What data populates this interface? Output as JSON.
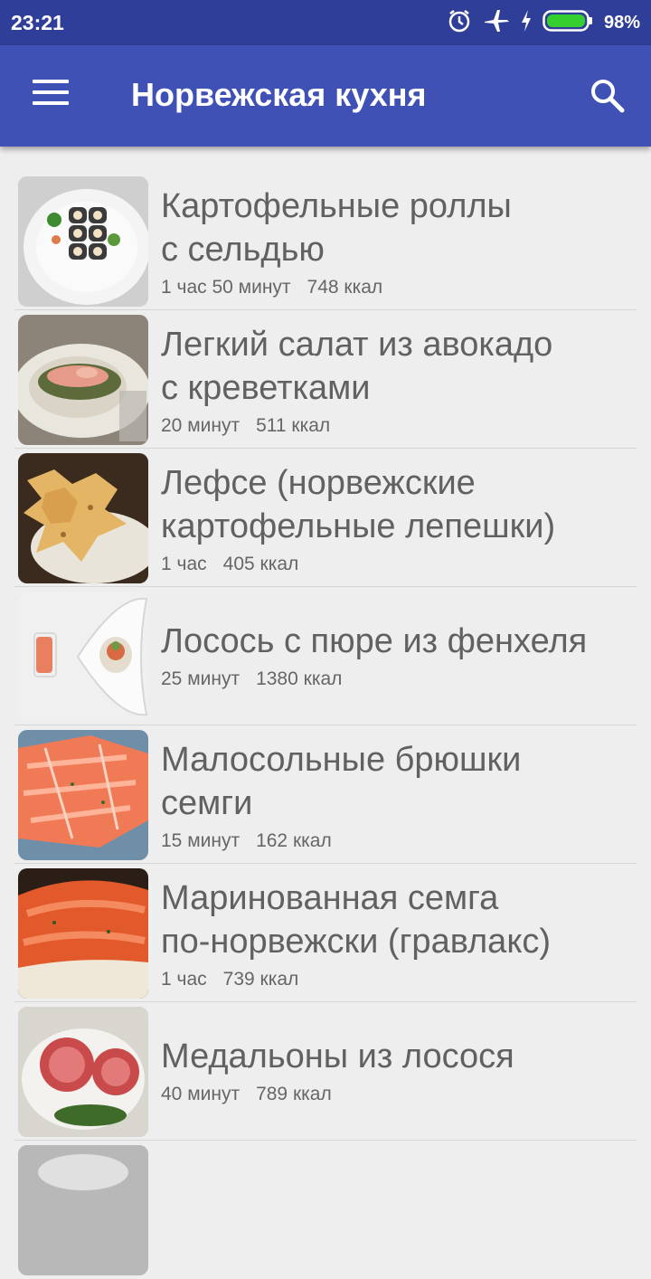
{
  "status": {
    "time": "23:21",
    "battery": "98%",
    "accent": "#2f3e98"
  },
  "appbar": {
    "title": "Норвежская кухня",
    "menu_icon": "menu-icon",
    "search_icon": "search-icon",
    "color": "#3f51b5"
  },
  "recipes": [
    {
      "title_line1": "Картофельные роллы",
      "title_line2": "с сельдью",
      "time": "1 час 50 минут",
      "kcal": "748 ккал"
    },
    {
      "title_line1": "Легкий салат из авокадо",
      "title_line2": "с креветками",
      "time": "20 минут",
      "kcal": "511 ккал"
    },
    {
      "title_line1": "Лефсе (норвежские",
      "title_line2": "картофельные лепешки)",
      "time": "1 час",
      "kcal": "405 ккал"
    },
    {
      "title_line1": "Лосось с пюре из фенхеля",
      "title_line2": "",
      "time": "25 минут",
      "kcal": "1380 ккал"
    },
    {
      "title_line1": "Малосольные брюшки",
      "title_line2": "семги",
      "time": "15 минут",
      "kcal": "162 ккал"
    },
    {
      "title_line1": "Маринованная семга",
      "title_line2": "по-норвежски (гравлакс)",
      "time": "1 час",
      "kcal": "739 ккал"
    },
    {
      "title_line1": "Медальоны из лосося",
      "title_line2": "",
      "time": "40 минут",
      "kcal": "789 ккал"
    }
  ]
}
